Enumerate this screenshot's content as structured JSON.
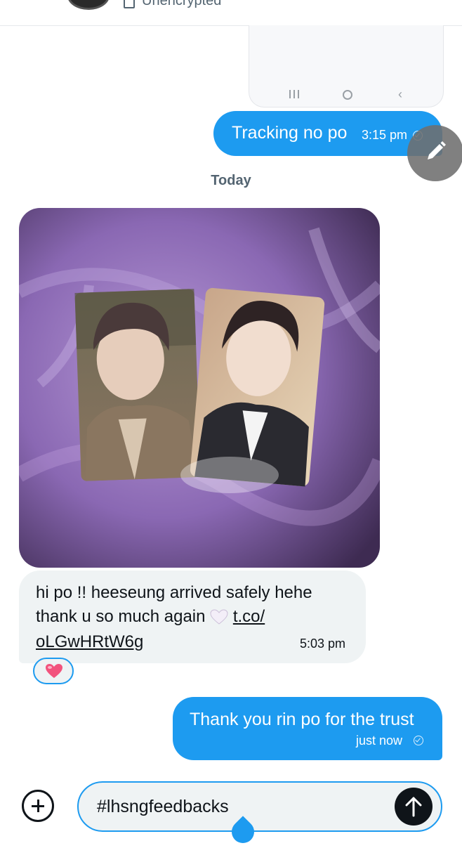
{
  "header": {
    "encryption_status": "Unencrypted",
    "avatar_icon": "avatar",
    "lock_icon": "lock-icon"
  },
  "phone_preview": {
    "nav_icons": [
      "recent-apps-icon",
      "home-icon",
      "back-icon"
    ]
  },
  "messages": [
    {
      "direction": "outgoing",
      "text": "Tracking no po",
      "time": "3:15 pm",
      "status_icon": "sent-check-icon"
    },
    {
      "direction": "separator",
      "text": "Today"
    },
    {
      "direction": "incoming",
      "type": "photo",
      "alt": ""
    },
    {
      "direction": "incoming",
      "text_line1": "hi po !! heeseung arrived safely hehe",
      "text_line2_prefix": "thank u so much again",
      "emoji": "white-heart",
      "link_part1": "t.co/",
      "link_part2": "oLGwHRtW6g",
      "time": "5:03 pm",
      "reaction": "pink-heart"
    },
    {
      "direction": "outgoing",
      "text": "Thank you rin po for the trust",
      "time": "just now",
      "status_icon": "sent-check-icon"
    }
  ],
  "composer": {
    "value": "#lhsngfeedbacks",
    "add_icon": "plus-circle-icon",
    "send_icon": "arrow-up-icon"
  },
  "fab": {
    "icon": "pencil-icon"
  },
  "colors": {
    "accent": "#1d9bf0",
    "incoming_bubble": "#eff3f4",
    "text": "#0f1419",
    "muted": "#536471"
  }
}
